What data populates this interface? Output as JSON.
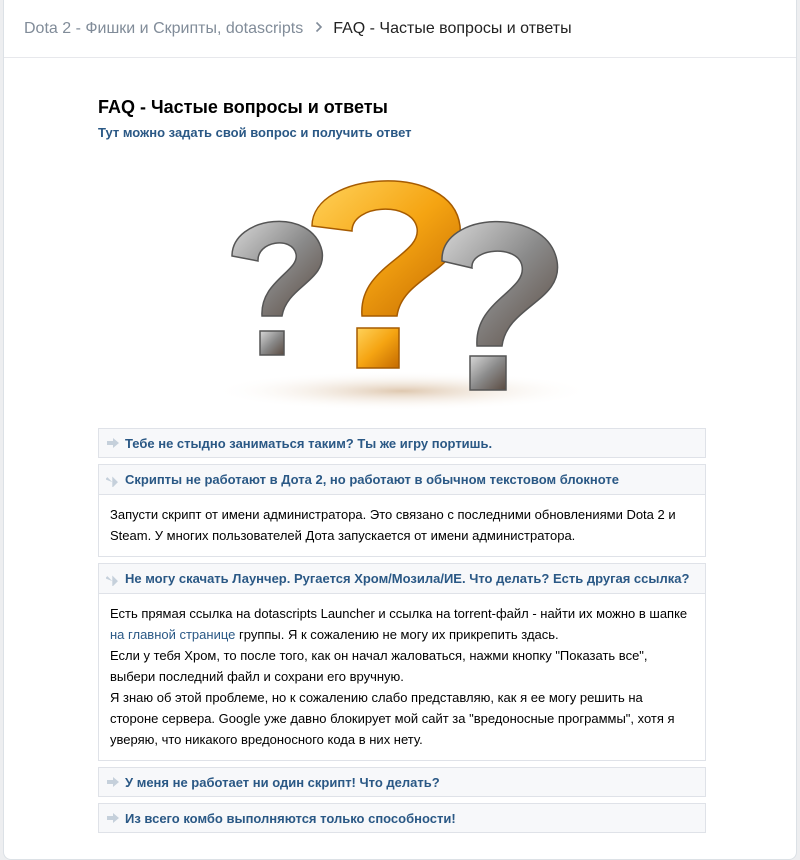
{
  "breadcrumb": {
    "parent": "Dota 2 - Фишки и Скрипты, dotascripts",
    "current": "FAQ - Частые вопросы и ответы"
  },
  "header": {
    "title": "FAQ - Частые вопросы и ответы",
    "subtitle": "Тут можно задать свой вопрос и получить ответ"
  },
  "colors": {
    "link": "#2a5885",
    "hero_orange": "#f5a412",
    "hero_grey": "#8a8a8a"
  },
  "faq": [
    {
      "question": "Тебе не стыдно заниматься таким? Ты же игру портишь.",
      "open": false
    },
    {
      "question": "Скрипты не работают в Дота 2, но работают в обычном текстовом блокноте",
      "open": true,
      "answer_p1": "Запусти скрипт от имени администратора. Это связано с последними обновлениями Dota 2 и Steam. У многих пользователей Дота запускается от имени администратора."
    },
    {
      "question": "Не могу скачать Лаунчер. Ругается Хром/Мозила/ИЕ. Что делать? Есть другая ссылка?",
      "open": true,
      "answer_p1_before": "Есть прямая ссылка на dotascripts Launcher и ссылка на torrent-файл - найти их можно в шапке",
      "answer_link": "на главной странице",
      "answer_p1_after": " группы. Я к сожалению не могу их прикрепить здась.",
      "answer_p2": "Если у тебя Хром, то после того, как он начал жаловаться, нажми кнопку \"Показать все\", выбери последний файл и сохрани его вручную.",
      "answer_p3": "Я знаю об этой проблеме, но к сожалению слабо представляю, как я ее могу решить на стороне сервера. Google уже давно блокирует мой сайт за \"вредоносные программы\", хотя я уверяю, что никакого вредоносного кода в них нету."
    },
    {
      "question": "У меня не работает ни один скрипт! Что делать?",
      "open": false
    },
    {
      "question": "Из всего комбо выполняются только способности!",
      "open": false
    }
  ]
}
